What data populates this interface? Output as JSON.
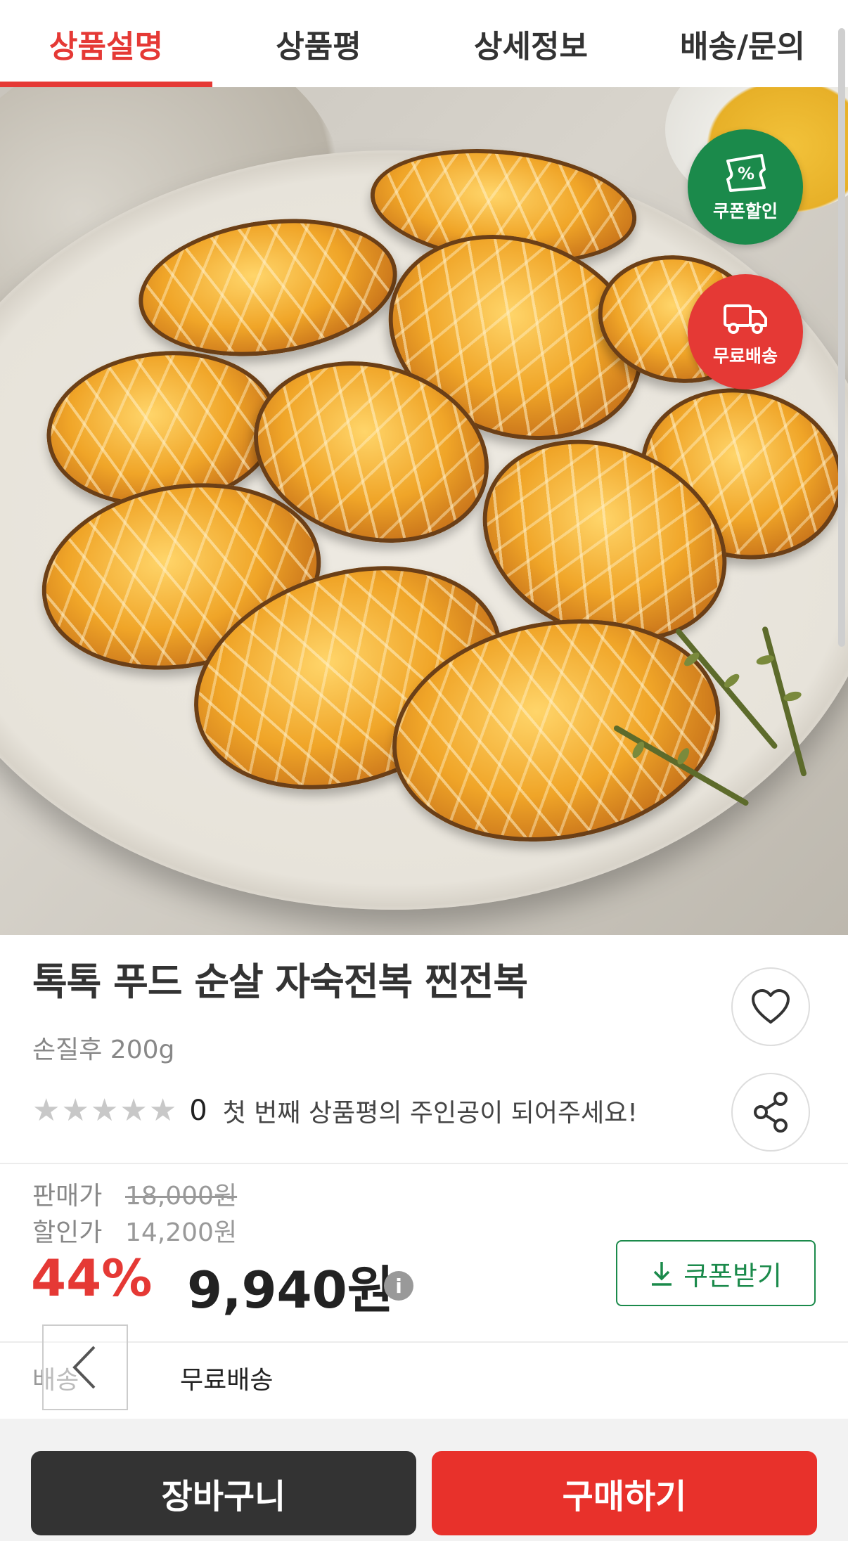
{
  "tabs": [
    {
      "label": "상품설명",
      "active": true
    },
    {
      "label": "상품평",
      "active": false
    },
    {
      "label": "상세정보",
      "active": false
    },
    {
      "label": "배송/문의",
      "active": false
    }
  ],
  "badges": {
    "coupon_label": "쿠폰할인",
    "coupon_icon_text": "%",
    "shipping_label": "무료배송"
  },
  "product": {
    "title": "톡톡 푸드 순살 자숙전복 찐전복",
    "subtitle": "손질후 200g",
    "rating": {
      "score": 0,
      "count_label": "0",
      "message": "첫 번째 상품평의 주인공이 되어주세요!"
    }
  },
  "price": {
    "list_label": "판매가",
    "list_value": "18,000원",
    "sale_label": "할인가",
    "sale_value": "14,200원",
    "discount": "44%",
    "final": "9,940원",
    "info_icon_text": "i",
    "coupon_button": "쿠폰받기"
  },
  "shipping": {
    "label": "배송",
    "value": "무료배송"
  },
  "actions": {
    "cart": "장바구니",
    "buy": "구매하기"
  },
  "colors": {
    "accent_red": "#e53935",
    "coupon_green": "#1b8a4b",
    "dark_button": "#333333",
    "buy_red": "#e8312b"
  },
  "icons": [
    "percent-coupon-icon",
    "truck-icon",
    "heart-icon",
    "share-icon",
    "star-icon",
    "info-icon",
    "download-icon",
    "chevron-left-icon"
  ]
}
